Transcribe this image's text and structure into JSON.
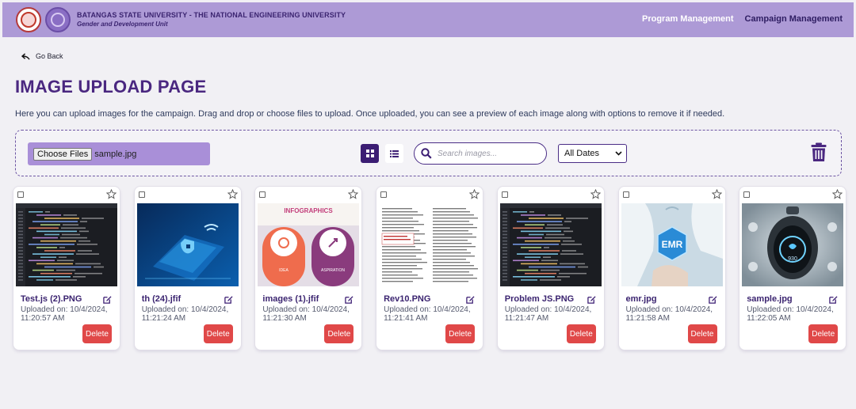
{
  "header": {
    "org_name": "BATANGAS STATE UNIVERSITY - THE NATIONAL ENGINEERING UNIVERSITY",
    "unit_name": "Gender and Development Unit",
    "nav": [
      "Program Management",
      "Campaign Management"
    ]
  },
  "back_label": "Go Back",
  "page_title": "IMAGE UPLOAD PAGE",
  "description": "Here you can upload images for the campaign. Drag and drop or choose files to upload. Once uploaded, you can see a preview of each image along with options to remove it if needed.",
  "upload": {
    "choose_label": "Choose Files",
    "selected_file": "sample.jpg",
    "search_placeholder": "Search images...",
    "date_filter": "All Dates"
  },
  "delete_label": "Delete",
  "images": [
    {
      "name": "Test.js (2).PNG",
      "uploaded": "Uploaded on: 10/4/2024, 11:20:57 AM",
      "thumb": "code"
    },
    {
      "name": "th (24).jfif",
      "uploaded": "Uploaded on: 10/4/2024, 11:21:24 AM",
      "thumb": "laptop"
    },
    {
      "name": "images (1).jfif",
      "uploaded": "Uploaded on: 10/4/2024, 11:21:30 AM",
      "thumb": "infographic"
    },
    {
      "name": "Rev10.PNG",
      "uploaded": "Uploaded on: 10/4/2024, 11:21:41 AM",
      "thumb": "document"
    },
    {
      "name": "Problem JS.PNG",
      "uploaded": "Uploaded on: 10/4/2024, 11:21:47 AM",
      "thumb": "code"
    },
    {
      "name": "emr.jpg",
      "uploaded": "Uploaded on: 10/4/2024, 11:21:58 AM",
      "thumb": "emr"
    },
    {
      "name": "sample.jpg",
      "uploaded": "Uploaded on: 10/4/2024, 11:22:05 AM",
      "thumb": "watch"
    }
  ],
  "thumb_text": {
    "infographic_title": "INFOGRAPHICS",
    "infographic_left": "IDEA",
    "infographic_right": "ASPIRATION",
    "emr_label": "EMR",
    "watch_value": "930"
  }
}
